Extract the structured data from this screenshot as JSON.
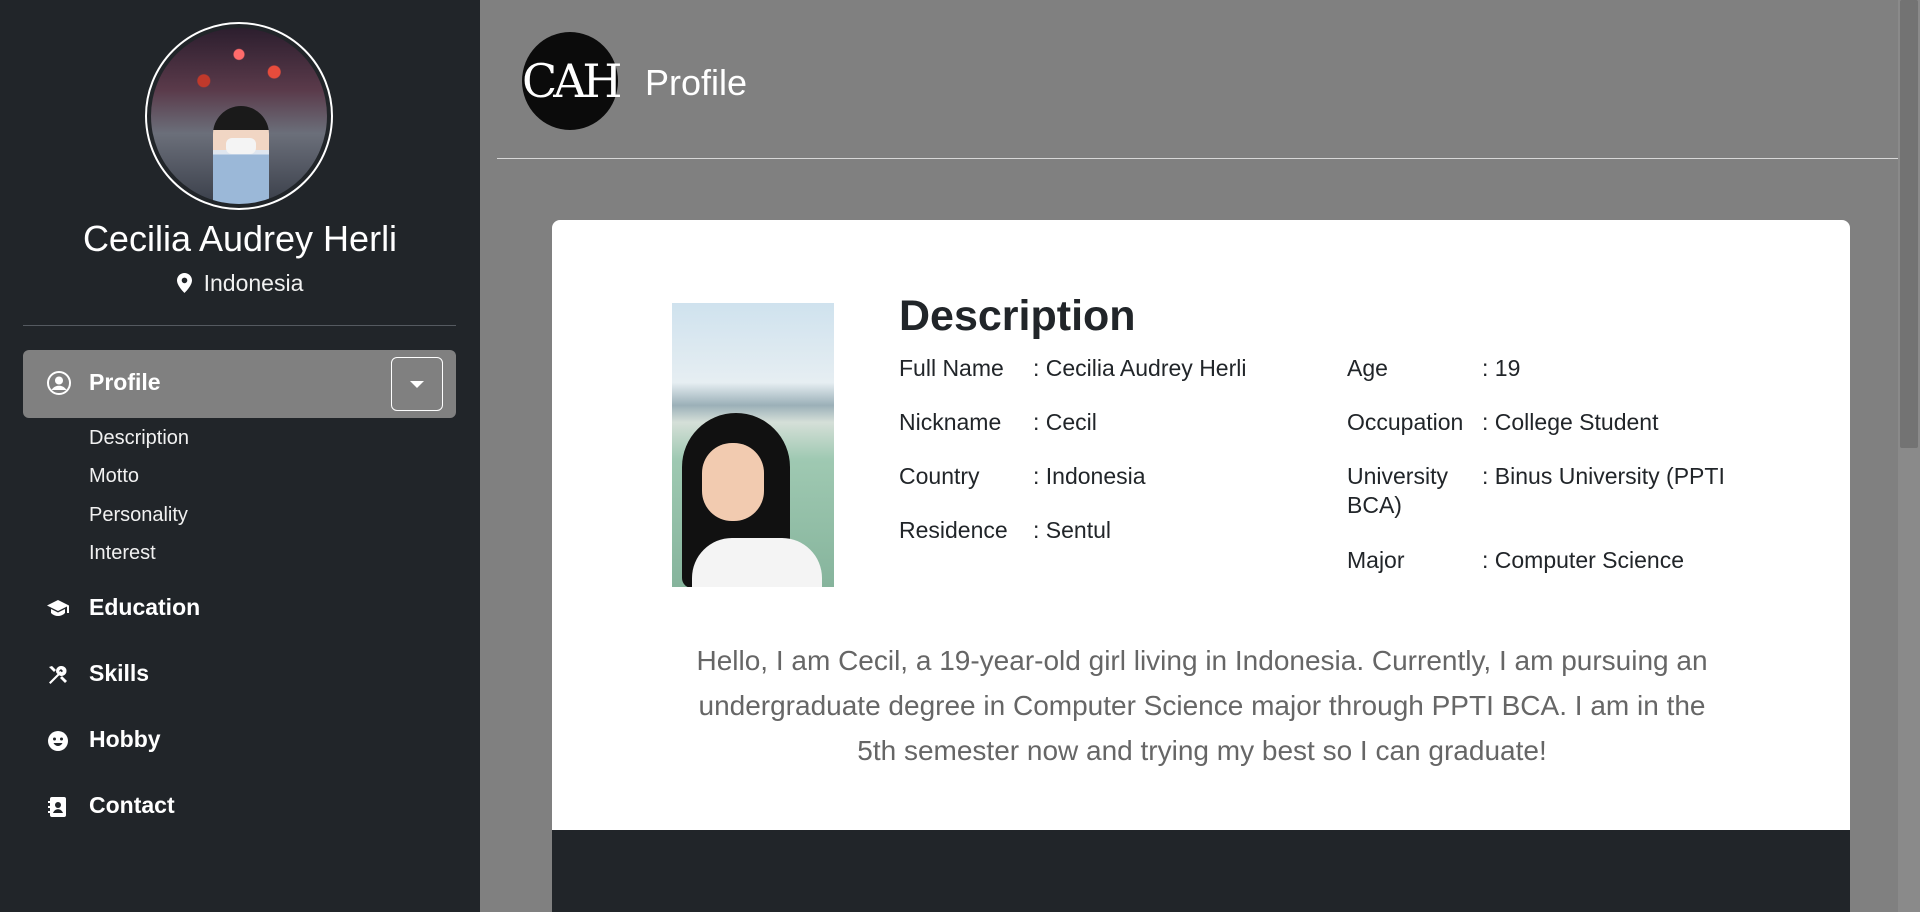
{
  "sidebar": {
    "name": "Cecilia Audrey Herli",
    "location": "Indonesia",
    "nav_active": {
      "label": "Profile",
      "icon": "user-circle-icon"
    },
    "sub_items": [
      "Description",
      "Motto",
      "Personality",
      "Interest"
    ],
    "nav_items": [
      {
        "label": "Education",
        "icon": "graduation-cap-icon"
      },
      {
        "label": "Skills",
        "icon": "tools-icon"
      },
      {
        "label": "Hobby",
        "icon": "smile-icon"
      },
      {
        "label": "Contact",
        "icon": "address-book-icon"
      }
    ]
  },
  "header": {
    "logo_text": "CAH",
    "title": "Profile"
  },
  "card": {
    "title": "Description",
    "left_fields": [
      {
        "key": "Full Name",
        "value": ": Cecilia Audrey Herli"
      },
      {
        "key": "Nickname",
        "value": ": Cecil"
      },
      {
        "key": "Country",
        "value": ": Indonesia"
      },
      {
        "key": "Residence",
        "value": ": Sentul"
      }
    ],
    "right_fields": [
      {
        "key": "Age",
        "value": ": 19"
      },
      {
        "key": "Occupation",
        "value": ": College Student"
      },
      {
        "key": "University BCA)",
        "key_line1": "University",
        "key_line2": "BCA)",
        "value": ": Binus University (PPTI"
      },
      {
        "key": "Major",
        "value": ": Computer Science"
      }
    ],
    "bio": "Hello, I am Cecil, a 19-year-old girl living in Indonesia. Currently, I am pursuing an undergraduate degree in Computer Science major through PPTI BCA. I am in the 5th semester now and trying my best so I can graduate!"
  },
  "colors": {
    "sidebar_bg": "#212529",
    "main_bg": "#808080",
    "active_nav": "#808080",
    "card_bg": "#ffffff"
  }
}
